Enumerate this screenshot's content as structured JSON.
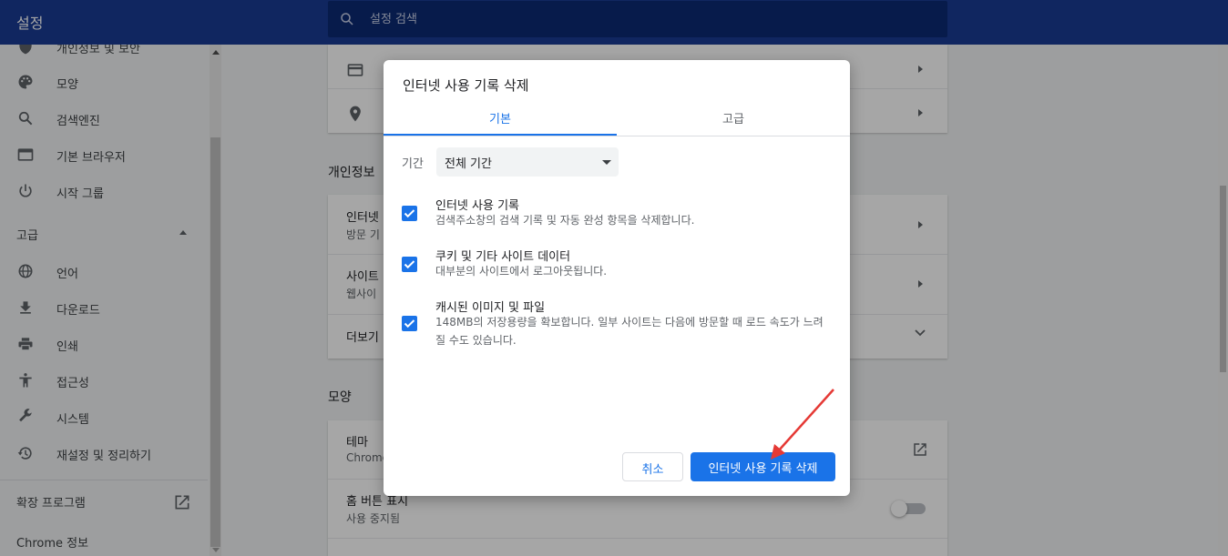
{
  "header": {
    "title": "설정",
    "search_placeholder": "설정 검색"
  },
  "sidebar": {
    "items": [
      {
        "label": "개인정보 및 보안",
        "icon": "shield-icon"
      },
      {
        "label": "모양",
        "icon": "palette-icon"
      },
      {
        "label": "검색엔진",
        "icon": "search-icon"
      },
      {
        "label": "기본 브라우저",
        "icon": "browser-icon"
      },
      {
        "label": "시작 그룹",
        "icon": "power-icon"
      }
    ],
    "advanced_label": "고급",
    "advanced_items": [
      {
        "label": "언어",
        "icon": "globe-icon"
      },
      {
        "label": "다운로드",
        "icon": "download-icon"
      },
      {
        "label": "인쇄",
        "icon": "print-icon"
      },
      {
        "label": "접근성",
        "icon": "accessibility-icon"
      },
      {
        "label": "시스템",
        "icon": "wrench-icon"
      },
      {
        "label": "재설정 및 정리하기",
        "icon": "history-icon"
      }
    ],
    "extensions_label": "확장 프로그램",
    "about_label": "Chrome 정보"
  },
  "main": {
    "privacy_section_title": "개인정보",
    "privacy_rows": [
      {
        "title": "인터넷",
        "subtitle": "방문 기"
      },
      {
        "title": "사이트",
        "subtitle": "웹사이"
      },
      {
        "title": "더보기",
        "subtitle": ""
      }
    ],
    "appearance_section_title": "모양",
    "theme_title": "테마",
    "theme_subtitle": "Chrome",
    "home_title": "홈 버튼 표시",
    "home_subtitle": "사용 중지됨"
  },
  "dialog": {
    "title": "인터넷 사용 기록 삭제",
    "tabs": {
      "basic": "기본",
      "advanced": "고급"
    },
    "time_range_label": "기간",
    "time_range_value": "전체 기간",
    "options": [
      {
        "title": "인터넷 사용 기록",
        "desc": "검색주소창의 검색 기록 및 자동 완성 항목을 삭제합니다.",
        "checked": true
      },
      {
        "title": "쿠키 및 기타 사이트 데이터",
        "desc": "대부분의 사이트에서 로그아웃됩니다.",
        "checked": true
      },
      {
        "title": "캐시된 이미지 및 파일",
        "desc": "148MB의 저장용량을 확보합니다. 일부 사이트는 다음에 방문할 때 로드 속도가 느려질 수도 있습니다.",
        "checked": true
      }
    ],
    "cancel_label": "취소",
    "delete_label": "인터넷 사용 기록 삭제"
  },
  "colors": {
    "header": "#1a3b94",
    "accent": "#1a73e8",
    "annotation_arrow": "#e53935"
  }
}
